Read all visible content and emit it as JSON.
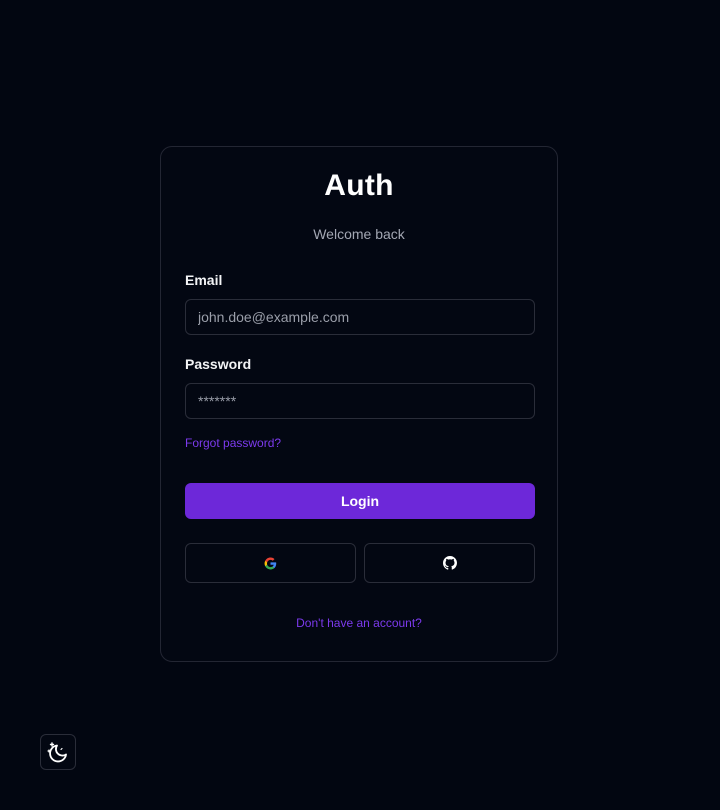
{
  "card": {
    "title": "Auth",
    "subtitle": "Welcome back"
  },
  "email": {
    "label": "Email",
    "placeholder": "john.doe@example.com",
    "value": ""
  },
  "password": {
    "label": "Password",
    "placeholder": "*******",
    "value": ""
  },
  "links": {
    "forgot_password": "Forgot password?",
    "signup": "Don't have an account?"
  },
  "buttons": {
    "login": "Login"
  },
  "social": [
    {
      "icon": "google-icon"
    },
    {
      "icon": "github-icon"
    }
  ],
  "theme_toggle": {
    "icon": "moon-stars-icon"
  },
  "colors": {
    "background": "#020611",
    "accent": "#6d28d9",
    "link": "#7c3aed"
  }
}
